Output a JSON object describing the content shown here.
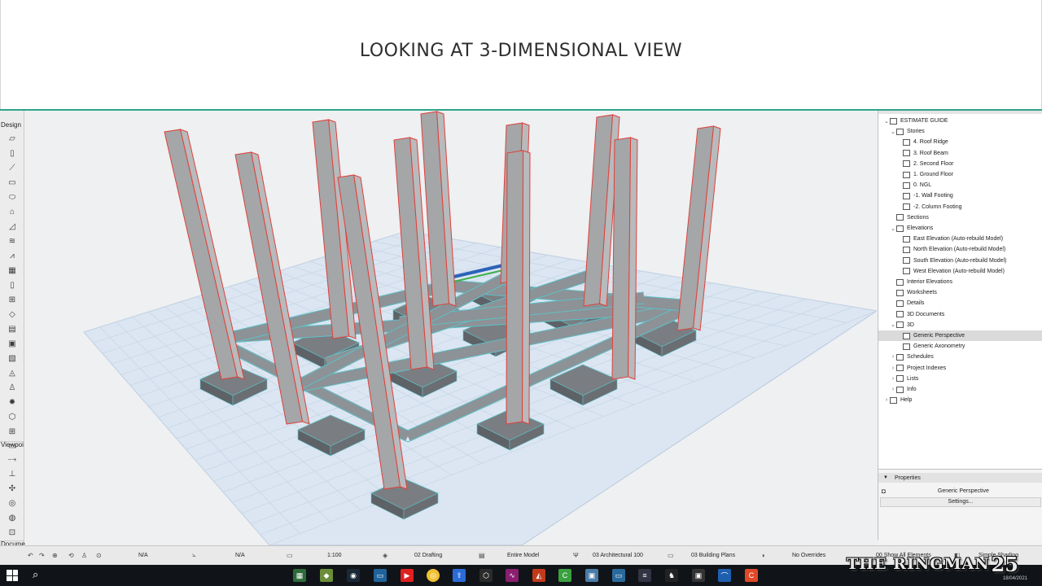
{
  "slide": {
    "title": "LOOKING AT 3-DIMENSIONAL VIEW"
  },
  "toolbox": {
    "sections": [
      "Design",
      "Viewpoi",
      "Docume"
    ]
  },
  "navigator": {
    "items": [
      {
        "label": "ESTIMATE GUIDE",
        "level": 0,
        "arrow": "v"
      },
      {
        "label": "Stories",
        "level": 1,
        "arrow": "v"
      },
      {
        "label": "4. Roof Ridge",
        "level": 2,
        "arrow": ""
      },
      {
        "label": "3. Roof Beam",
        "level": 2,
        "arrow": ""
      },
      {
        "label": "2. Second Floor",
        "level": 2,
        "arrow": ""
      },
      {
        "label": "1. Ground Floor",
        "level": 2,
        "arrow": ""
      },
      {
        "label": "0. NGL",
        "level": 2,
        "arrow": ""
      },
      {
        "label": "-1. Wall Footing",
        "level": 2,
        "arrow": ""
      },
      {
        "label": "-2. Column Footing",
        "level": 2,
        "arrow": ""
      },
      {
        "label": "Sections",
        "level": 1,
        "arrow": ""
      },
      {
        "label": "Elevations",
        "level": 1,
        "arrow": "v"
      },
      {
        "label": "East Elevation (Auto-rebuild Model)",
        "level": 2,
        "arrow": ""
      },
      {
        "label": "North Elevation (Auto-rebuild Model)",
        "level": 2,
        "arrow": ""
      },
      {
        "label": "South Elevation (Auto-rebuild Model)",
        "level": 2,
        "arrow": ""
      },
      {
        "label": "West Elevation (Auto-rebuild Model)",
        "level": 2,
        "arrow": ""
      },
      {
        "label": "Interior Elevations",
        "level": 1,
        "arrow": ""
      },
      {
        "label": "Worksheets",
        "level": 1,
        "arrow": ""
      },
      {
        "label": "Details",
        "level": 1,
        "arrow": ""
      },
      {
        "label": "3D Documents",
        "level": 1,
        "arrow": ""
      },
      {
        "label": "3D",
        "level": 1,
        "arrow": "v"
      },
      {
        "label": "Generic Perspective",
        "level": 2,
        "arrow": "",
        "selected": true
      },
      {
        "label": "Generic Axonometry",
        "level": 2,
        "arrow": ""
      },
      {
        "label": "Schedules",
        "level": 1,
        "arrow": ">"
      },
      {
        "label": "Project Indexes",
        "level": 1,
        "arrow": ">"
      },
      {
        "label": "Lists",
        "level": 1,
        "arrow": ">"
      },
      {
        "label": "Info",
        "level": 1,
        "arrow": ">"
      },
      {
        "label": "Help",
        "level": 0,
        "arrow": ">"
      }
    ]
  },
  "properties": {
    "header": "Properties",
    "value": "Generic Perspective",
    "settings_label": "Settings..."
  },
  "statusbar": {
    "zoom_value": "N/A",
    "angle_value": "N/A",
    "scale": "1:100",
    "layer_combo": "02 Drafting",
    "model_view": "Entire Model",
    "pen_set": "03 Architectural 100",
    "dimension": "03 Building Plans",
    "overrides": "No Overrides",
    "renovation": "00 Show All Elements",
    "shading": "Simple Shading"
  },
  "taskbar": {
    "date": "18/04/2021"
  },
  "watermark": {
    "text": "THE RINGMAN",
    "number": "25"
  },
  "colors": {
    "accent_line": "#2ea58a",
    "column_edge": "#e0403a",
    "beam_edge": "#5fc0c8",
    "selected_beam": "#2b63b8"
  }
}
